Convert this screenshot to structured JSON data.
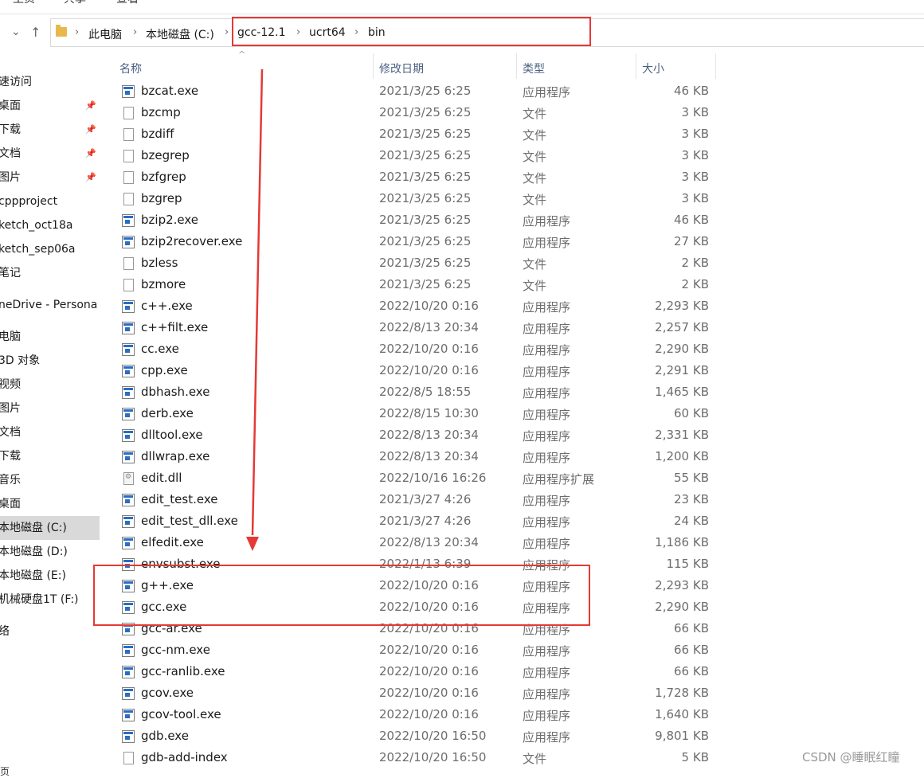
{
  "ribbon": {
    "tabs": [
      "主页",
      "共享",
      "查看"
    ]
  },
  "address": {
    "crumbs": [
      "此电脑",
      "本地磁盘 (C:)",
      "gcc-12.1",
      "ucrt64",
      "bin"
    ]
  },
  "nav": {
    "items": [
      {
        "label": "速访问",
        "pinned": false
      },
      {
        "label": "桌面",
        "pinned": true
      },
      {
        "label": "下载",
        "pinned": true
      },
      {
        "label": "文档",
        "pinned": true
      },
      {
        "label": "图片",
        "pinned": true
      },
      {
        "label": "cppproject",
        "pinned": false
      },
      {
        "label": "ketch_oct18a",
        "pinned": false
      },
      {
        "label": "ketch_sep06a",
        "pinned": false
      },
      {
        "label": "笔记",
        "pinned": false
      },
      {
        "label": "neDrive - Persona",
        "pinned": false
      },
      {
        "label": "电脑",
        "pinned": false
      },
      {
        "label": "3D 对象",
        "pinned": false
      },
      {
        "label": "视频",
        "pinned": false
      },
      {
        "label": "图片",
        "pinned": false
      },
      {
        "label": "文档",
        "pinned": false
      },
      {
        "label": "下载",
        "pinned": false
      },
      {
        "label": "音乐",
        "pinned": false
      },
      {
        "label": "桌面",
        "pinned": false
      },
      {
        "label": "本地磁盘 (C:)",
        "pinned": false,
        "selected": true
      },
      {
        "label": "本地磁盘 (D:)",
        "pinned": false
      },
      {
        "label": "本地磁盘 (E:)",
        "pinned": false
      },
      {
        "label": "机械硬盘1T (F:)",
        "pinned": false
      },
      {
        "label": "络",
        "pinned": false
      }
    ],
    "bottom_cut": "页"
  },
  "columns": {
    "name": "名称",
    "date": "修改日期",
    "type": "类型",
    "size": "大小"
  },
  "files": [
    {
      "name": "bzcat.exe",
      "date": "2021/3/25 6:25",
      "type": "应用程序",
      "size": "46 KB",
      "icon": "exe-icon"
    },
    {
      "name": "bzcmp",
      "date": "2021/3/25 6:25",
      "type": "文件",
      "size": "3 KB",
      "icon": "file-icon"
    },
    {
      "name": "bzdiff",
      "date": "2021/3/25 6:25",
      "type": "文件",
      "size": "3 KB",
      "icon": "file-icon"
    },
    {
      "name": "bzegrep",
      "date": "2021/3/25 6:25",
      "type": "文件",
      "size": "3 KB",
      "icon": "file-icon"
    },
    {
      "name": "bzfgrep",
      "date": "2021/3/25 6:25",
      "type": "文件",
      "size": "3 KB",
      "icon": "file-icon"
    },
    {
      "name": "bzgrep",
      "date": "2021/3/25 6:25",
      "type": "文件",
      "size": "3 KB",
      "icon": "file-icon"
    },
    {
      "name": "bzip2.exe",
      "date": "2021/3/25 6:25",
      "type": "应用程序",
      "size": "46 KB",
      "icon": "exe-icon"
    },
    {
      "name": "bzip2recover.exe",
      "date": "2021/3/25 6:25",
      "type": "应用程序",
      "size": "27 KB",
      "icon": "exe-icon"
    },
    {
      "name": "bzless",
      "date": "2021/3/25 6:25",
      "type": "文件",
      "size": "2 KB",
      "icon": "file-icon"
    },
    {
      "name": "bzmore",
      "date": "2021/3/25 6:25",
      "type": "文件",
      "size": "2 KB",
      "icon": "file-icon"
    },
    {
      "name": "c++.exe",
      "date": "2022/10/20 0:16",
      "type": "应用程序",
      "size": "2,293 KB",
      "icon": "exe-icon"
    },
    {
      "name": "c++filt.exe",
      "date": "2022/8/13 20:34",
      "type": "应用程序",
      "size": "2,257 KB",
      "icon": "exe-icon"
    },
    {
      "name": "cc.exe",
      "date": "2022/10/20 0:16",
      "type": "应用程序",
      "size": "2,290 KB",
      "icon": "exe-icon"
    },
    {
      "name": "cpp.exe",
      "date": "2022/10/20 0:16",
      "type": "应用程序",
      "size": "2,291 KB",
      "icon": "exe-icon"
    },
    {
      "name": "dbhash.exe",
      "date": "2022/8/5 18:55",
      "type": "应用程序",
      "size": "1,465 KB",
      "icon": "exe-icon"
    },
    {
      "name": "derb.exe",
      "date": "2022/8/15 10:30",
      "type": "应用程序",
      "size": "60 KB",
      "icon": "exe-icon"
    },
    {
      "name": "dlltool.exe",
      "date": "2022/8/13 20:34",
      "type": "应用程序",
      "size": "2,331 KB",
      "icon": "exe-icon"
    },
    {
      "name": "dllwrap.exe",
      "date": "2022/8/13 20:34",
      "type": "应用程序",
      "size": "1,200 KB",
      "icon": "exe-icon"
    },
    {
      "name": "edit.dll",
      "date": "2022/10/16 16:26",
      "type": "应用程序扩展",
      "size": "55 KB",
      "icon": "dll-icon"
    },
    {
      "name": "edit_test.exe",
      "date": "2021/3/27 4:26",
      "type": "应用程序",
      "size": "23 KB",
      "icon": "exe-icon"
    },
    {
      "name": "edit_test_dll.exe",
      "date": "2021/3/27 4:26",
      "type": "应用程序",
      "size": "24 KB",
      "icon": "exe-icon"
    },
    {
      "name": "elfedit.exe",
      "date": "2022/8/13 20:34",
      "type": "应用程序",
      "size": "1,186 KB",
      "icon": "exe-icon"
    },
    {
      "name": "envsubst.exe",
      "date": "2022/1/13 6:39",
      "type": "应用程序",
      "size": "115 KB",
      "icon": "exe-icon"
    },
    {
      "name": "g++.exe",
      "date": "2022/10/20 0:16",
      "type": "应用程序",
      "size": "2,293 KB",
      "icon": "exe-icon"
    },
    {
      "name": "gcc.exe",
      "date": "2022/10/20 0:16",
      "type": "应用程序",
      "size": "2,290 KB",
      "icon": "exe-icon"
    },
    {
      "name": "gcc-ar.exe",
      "date": "2022/10/20 0:16",
      "type": "应用程序",
      "size": "66 KB",
      "icon": "exe-icon"
    },
    {
      "name": "gcc-nm.exe",
      "date": "2022/10/20 0:16",
      "type": "应用程序",
      "size": "66 KB",
      "icon": "exe-icon"
    },
    {
      "name": "gcc-ranlib.exe",
      "date": "2022/10/20 0:16",
      "type": "应用程序",
      "size": "66 KB",
      "icon": "exe-icon"
    },
    {
      "name": "gcov.exe",
      "date": "2022/10/20 0:16",
      "type": "应用程序",
      "size": "1,728 KB",
      "icon": "exe-icon"
    },
    {
      "name": "gcov-tool.exe",
      "date": "2022/10/20 0:16",
      "type": "应用程序",
      "size": "1,640 KB",
      "icon": "exe-icon"
    },
    {
      "name": "gdb.exe",
      "date": "2022/10/20 16:50",
      "type": "应用程序",
      "size": "9,801 KB",
      "icon": "exe-icon"
    },
    {
      "name": "gdb-add-index",
      "date": "2022/10/20 16:50",
      "type": "文件",
      "size": "5 KB",
      "icon": "file-icon"
    }
  ],
  "watermark": "CSDN @睡眠红瞳",
  "colors": {
    "highlight": "#e53935",
    "selected_nav": "#d9d9d9",
    "header_text": "#4d6082"
  }
}
